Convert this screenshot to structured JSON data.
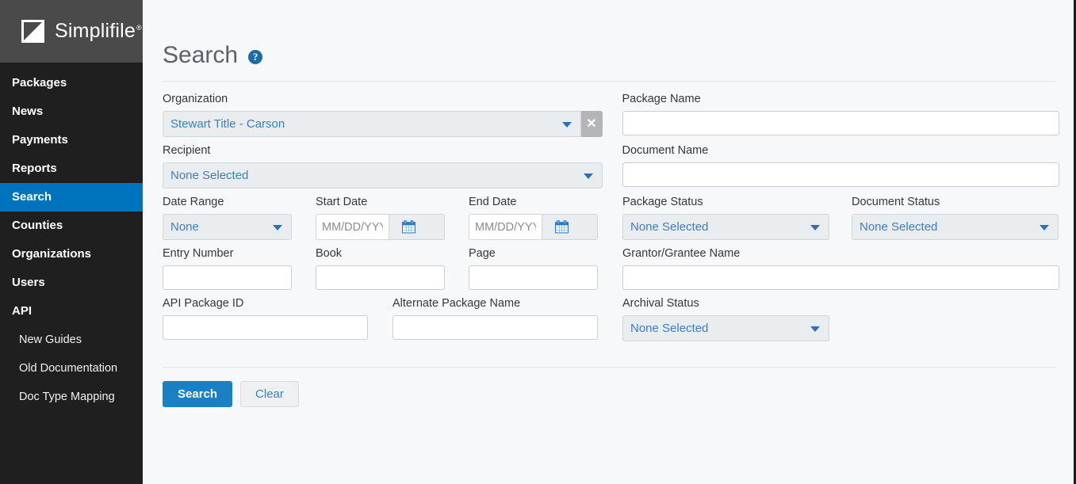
{
  "brand": {
    "name": "Simplifile",
    "registered": "®"
  },
  "sidebar": {
    "items": [
      {
        "label": "Packages",
        "active": false,
        "sub": false
      },
      {
        "label": "News",
        "active": false,
        "sub": false
      },
      {
        "label": "Payments",
        "active": false,
        "sub": false
      },
      {
        "label": "Reports",
        "active": false,
        "sub": false
      },
      {
        "label": "Search",
        "active": true,
        "sub": false
      },
      {
        "label": "Counties",
        "active": false,
        "sub": false
      },
      {
        "label": "Organizations",
        "active": false,
        "sub": false
      },
      {
        "label": "Users",
        "active": false,
        "sub": false
      },
      {
        "label": "API",
        "active": false,
        "sub": false
      },
      {
        "label": "New Guides",
        "active": false,
        "sub": true
      },
      {
        "label": "Old Documentation",
        "active": false,
        "sub": true
      },
      {
        "label": "Doc Type Mapping",
        "active": false,
        "sub": true
      }
    ]
  },
  "header": {
    "title": "Search",
    "help_icon": "question-mark-circle-icon",
    "help_glyph": "?"
  },
  "form": {
    "organization": {
      "label": "Organization",
      "value": "Stewart Title - Carson",
      "clear_glyph": "✕"
    },
    "recipient": {
      "label": "Recipient",
      "value": "None Selected"
    },
    "package_name": {
      "label": "Package Name",
      "value": "",
      "placeholder": ""
    },
    "document_name": {
      "label": "Document Name",
      "value": "",
      "placeholder": ""
    },
    "date_range": {
      "label": "Date Range",
      "value": "None"
    },
    "start_date": {
      "label": "Start Date",
      "value": "",
      "placeholder": "MM/DD/YYYY"
    },
    "end_date": {
      "label": "End Date",
      "value": "",
      "placeholder": "MM/DD/YYYY"
    },
    "package_status": {
      "label": "Package Status",
      "value": "None Selected"
    },
    "document_status": {
      "label": "Document Status",
      "value": "None Selected"
    },
    "entry_number": {
      "label": "Entry Number",
      "value": "",
      "placeholder": ""
    },
    "book": {
      "label": "Book",
      "value": "",
      "placeholder": ""
    },
    "page": {
      "label": "Page",
      "value": "",
      "placeholder": ""
    },
    "grantor_grantee_name": {
      "label": "Grantor/Grantee Name",
      "value": "",
      "placeholder": ""
    },
    "api_package_id": {
      "label": "API Package ID",
      "value": "",
      "placeholder": ""
    },
    "alternate_package_name": {
      "label": "Alternate Package Name",
      "value": "",
      "placeholder": ""
    },
    "archival_status": {
      "label": "Archival Status",
      "value": "None Selected"
    }
  },
  "actions": {
    "search_label": "Search",
    "clear_label": "Clear"
  },
  "colors": {
    "sidebar_bg": "#1f1f1f",
    "sidebar_brand_bg": "#4a4a4a",
    "active_nav": "#0073bf",
    "accent_blue": "#1b7fc4",
    "link_blue": "#3d7ec0",
    "page_bg": "#f7f8fa"
  }
}
